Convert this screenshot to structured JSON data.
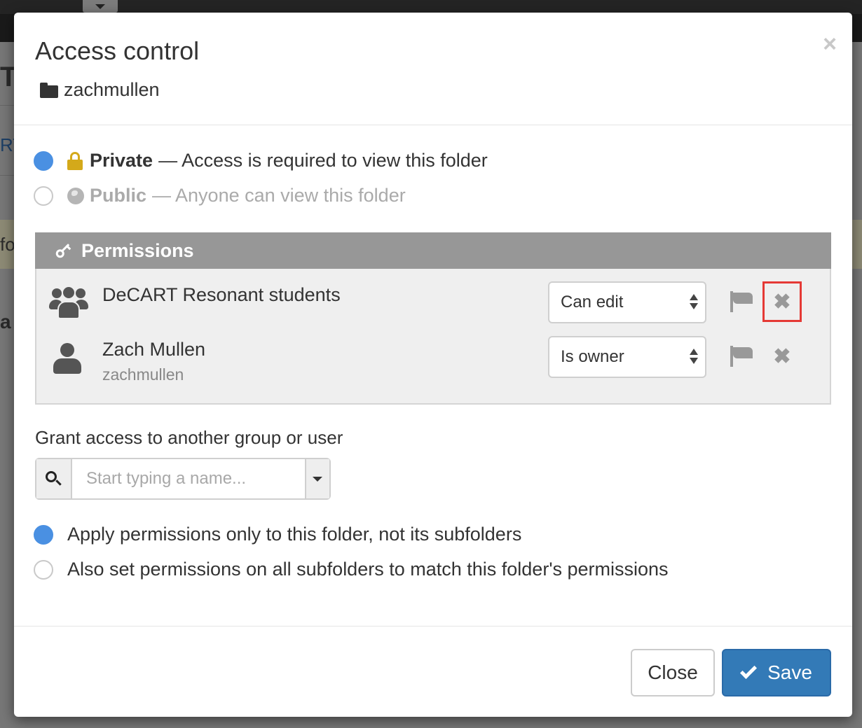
{
  "background": {
    "letters": [
      "T",
      "RT",
      "fo",
      "a"
    ]
  },
  "modal": {
    "title": "Access control",
    "folder_name": "zachmullen",
    "close_glyph": "×"
  },
  "visibility": {
    "private": {
      "label": "Private",
      "desc": "— Access is required to view this folder",
      "selected": true,
      "icon": "lock-icon",
      "color": "#d4a91a"
    },
    "public": {
      "label": "Public",
      "desc": "— Anyone can view this folder",
      "selected": false,
      "icon": "globe-icon"
    }
  },
  "permissions": {
    "title": "Permissions",
    "entries": [
      {
        "type": "group",
        "name": "DeCART Resonant students",
        "login": "",
        "level": "Can edit"
      },
      {
        "type": "user",
        "name": "Zach Mullen",
        "login": "zachmullen",
        "level": "Is owner"
      }
    ],
    "remove_glyph": "✖"
  },
  "grant": {
    "label": "Grant access to another group or user",
    "placeholder": "Start typing a name..."
  },
  "recurse": {
    "only_folder": "Apply permissions only to this folder, not its subfolders",
    "all_subfolders": "Also set permissions on all subfolders to match this folder's permissions",
    "selected": "only_folder"
  },
  "footer": {
    "close_label": "Close",
    "save_label": "Save"
  },
  "colors": {
    "accent": "#4a90e2",
    "primary_button": "#337ab7",
    "highlight": "#e53935",
    "panel_header": "#979797"
  }
}
